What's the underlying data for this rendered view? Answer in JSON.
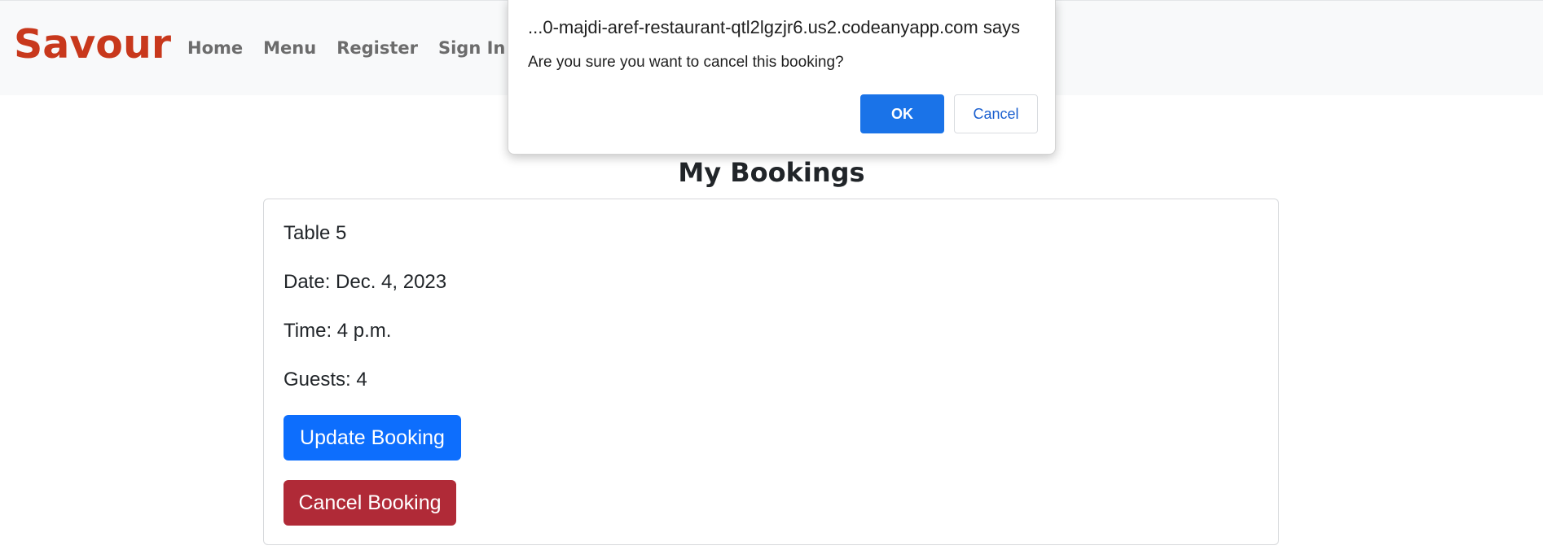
{
  "navbar": {
    "brand": "Savour",
    "links": [
      {
        "label": "Home"
      },
      {
        "label": "Menu"
      },
      {
        "label": "Register"
      },
      {
        "label": "Sign In"
      }
    ]
  },
  "main": {
    "title": "My Bookings",
    "booking": {
      "table": "Table 5",
      "date": "Date: Dec. 4, 2023",
      "time": "Time: 4 p.m.",
      "guests": "Guests: 4",
      "update_label": "Update Booking",
      "cancel_label": "Cancel Booking"
    }
  },
  "dialog": {
    "title": "...0-majdi-aref-restaurant-qtl2lgzjr6.us2.codeanyapp.com says",
    "message": "Are you sure you want to cancel this booking?",
    "ok_label": "OK",
    "cancel_label": "Cancel"
  },
  "colors": {
    "brand": "#c8381c",
    "primary": "#0d6efd",
    "danger": "#b02a37",
    "dialog_ok": "#1a73e8"
  }
}
